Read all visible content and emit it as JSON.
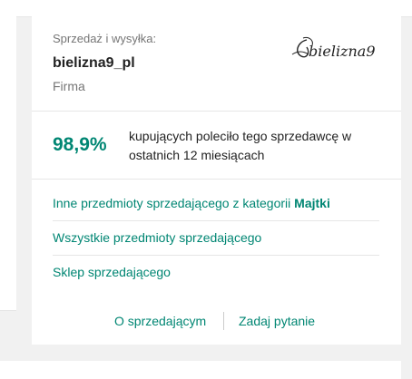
{
  "seller": {
    "caption": "Sprzedaż i wysyłka:",
    "name": "bielizna9_pl",
    "type": "Firma",
    "logo_text": "bielizna9"
  },
  "rating": {
    "percent": "98,9%",
    "text": "kupujących poleciło tego sprzedawcę w ostatnich 12 miesiącach"
  },
  "links": {
    "other_items_prefix": "Inne przedmioty sprzedającego z kategorii ",
    "other_items_category": "Majtki",
    "all_items": "Wszystkie przedmioty sprzedającego",
    "shop": "Sklep sprzedającego"
  },
  "footer": {
    "about": "O sprzedającym",
    "ask": "Zadaj pytanie"
  },
  "colors": {
    "accent": "#008673",
    "text": "#222222",
    "muted": "#767676"
  }
}
